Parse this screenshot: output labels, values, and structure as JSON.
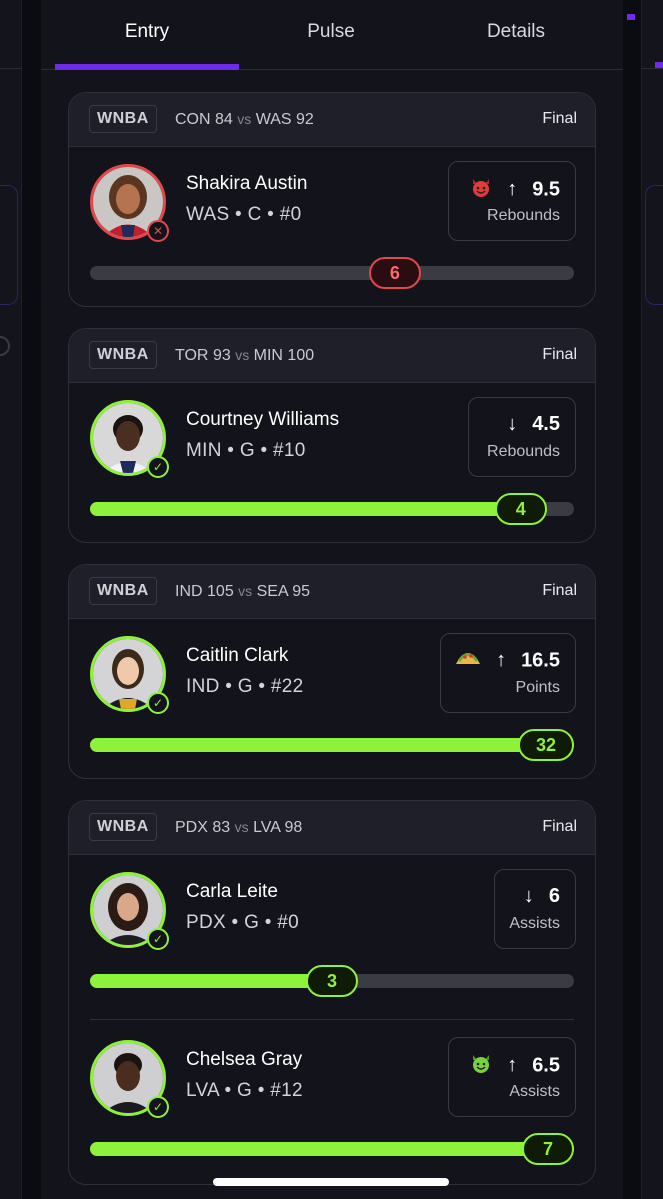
{
  "tabs": [
    {
      "label": "Entry",
      "active": true
    },
    {
      "label": "Pulse",
      "active": false
    },
    {
      "label": "Details",
      "active": false
    }
  ],
  "colors": {
    "accent": "#6f2ce8",
    "win": "#8ef13a",
    "loss": "#e0494b"
  },
  "cards": [
    {
      "league": "WNBA",
      "team1": "CON",
      "score1": "84",
      "vs": "vs",
      "team2": "WAS",
      "score2": "92",
      "status": "Final",
      "players": [
        {
          "name": "Shakira Austin",
          "info": "WAS • C • #0",
          "result": "loss",
          "result_icon": "close-icon",
          "emoji": "😈",
          "emoji_name": "devil-emoji",
          "direction": "up",
          "arrow": "↑",
          "line": "9.5",
          "stat": "Rebounds",
          "actual": "6",
          "progress": 0.63
        }
      ]
    },
    {
      "league": "WNBA",
      "team1": "TOR",
      "score1": "93",
      "vs": "vs",
      "team2": "MIN",
      "score2": "100",
      "status": "Final",
      "players": [
        {
          "name": "Courtney Williams",
          "info": "MIN • G • #10",
          "result": "win",
          "result_icon": "check-icon",
          "emoji": "",
          "emoji_name": "",
          "direction": "down",
          "arrow": "↓",
          "line": "4.5",
          "stat": "Rebounds",
          "actual": "4",
          "progress": 0.89
        }
      ]
    },
    {
      "league": "WNBA",
      "team1": "IND",
      "score1": "105",
      "vs": "vs",
      "team2": "SEA",
      "score2": "95",
      "status": "Final",
      "players": [
        {
          "name": "Caitlin Clark",
          "info": "IND • G • #22",
          "result": "win",
          "result_icon": "check-icon",
          "emoji": "🌮",
          "emoji_name": "taco-emoji",
          "direction": "up",
          "arrow": "↑",
          "line": "16.5",
          "stat": "Points",
          "actual": "32",
          "progress": 1.0
        }
      ]
    },
    {
      "league": "WNBA",
      "team1": "PDX",
      "score1": "83",
      "vs": "vs",
      "team2": "LVA",
      "score2": "98",
      "status": "Final",
      "players": [
        {
          "name": "Carla Leite",
          "info": "PDX • G • #0",
          "result": "win",
          "result_icon": "check-icon",
          "emoji": "",
          "emoji_name": "",
          "direction": "down",
          "arrow": "↓",
          "line": "6",
          "stat": "Assists",
          "actual": "3",
          "progress": 0.5
        },
        {
          "name": "Chelsea Gray",
          "info": "LVA • G • #12",
          "result": "win",
          "result_icon": "check-icon",
          "emoji": "😈",
          "emoji_name": "green-devil-emoji",
          "direction": "up",
          "arrow": "↑",
          "line": "6.5",
          "stat": "Assists",
          "actual": "7",
          "progress": 1.0
        }
      ]
    }
  ]
}
